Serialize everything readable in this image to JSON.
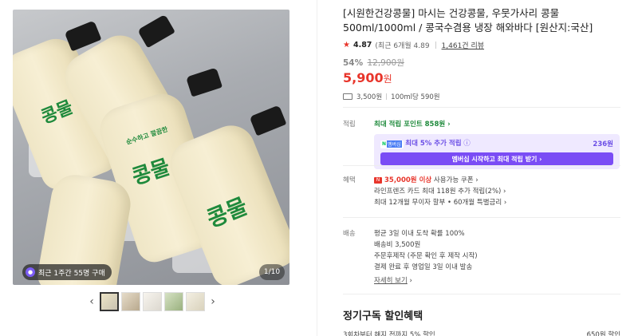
{
  "gallery": {
    "bottle_text": "콩물",
    "bottle_subtext": "순수하고 깔끔한",
    "recent_buy_label": "최근 1주간 55명 구매",
    "counter": "1/10",
    "prev_icon": "chevron-left-icon",
    "next_icon": "chevron-right-icon",
    "thumbnail_count": 5
  },
  "product": {
    "title": "[시원한건강콩물] 마시는 건강콩물, 우뭇가사리 콩물500ml/1000ml / 콩국수겸용 냉장 해와바다 [원산지:국산]",
    "rating_score": "4.87",
    "rating_recent": "(최근 6개월 4.89",
    "review_count": "1,461건 리뷰",
    "discount": "54%",
    "original_price": "12,900원",
    "price": "5,900",
    "price_unit": "원",
    "shipping_fee": "3,500원",
    "unit_price": "100ml당 590원"
  },
  "points": {
    "label": "적립",
    "max_points": "최대 적립 포인트 858원",
    "badge_n": "N",
    "badge_m": "멤버십",
    "extra_label": "최대 5% 추가 적립",
    "extra_value": "236원",
    "join_button": "멤버십 시작하고 최대 적립 받기"
  },
  "benefits": {
    "label": "혜택",
    "coupon_amount": "35,000원 이상",
    "coupon_text": " 사용가능 쿠폰",
    "card_line": "라인프렌즈 카드 최대 118원 추가 적립(2%)",
    "installment": "최대 12개월 무이자 할부 • 60개월 특별금리"
  },
  "delivery": {
    "label": "배송",
    "line1": "평균 3일 이내 도착 확률 100%",
    "line2": "배송비 3,500원",
    "line3": "주문후제작 (주문 확인 후 제작 시작)",
    "line4": "결제 완료 후 영업일 3일 이내 발송",
    "more": "자세히 보기"
  },
  "subscription": {
    "title": "정기구독 할인혜택",
    "row_left": "3회차부터 해지 전까지 5% 할인",
    "row_right": "650원 할인"
  },
  "colors": {
    "accent_red": "#e8352b",
    "point_green": "#1f8a3c",
    "membership_purple": "#7a4cf5",
    "membership_bg": "#efe9ff"
  }
}
